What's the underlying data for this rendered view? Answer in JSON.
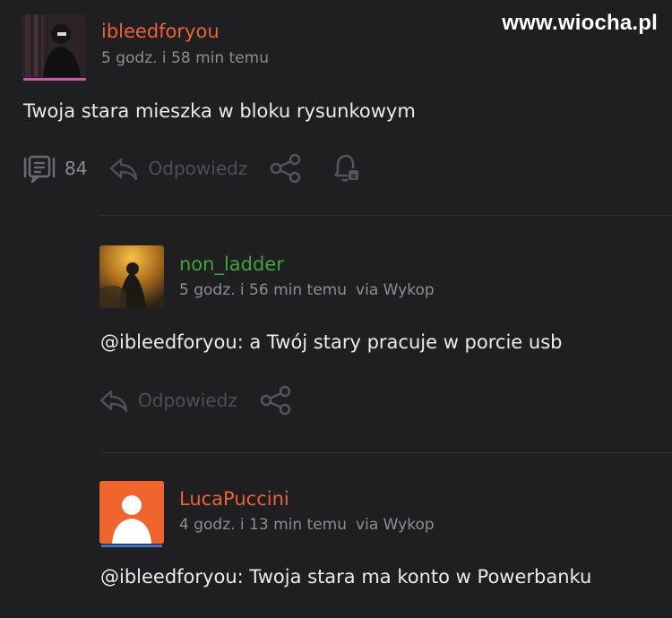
{
  "watermark": "www.wiocha.pl",
  "post": {
    "author": "ibleedforyou",
    "time": "5 godz. i 58 min temu",
    "text": "Twoja stara mieszka w bloku rysunkowym",
    "comment_count": "84",
    "reply_label": "Odpowiedz",
    "author_color": "#e8623c"
  },
  "comments": [
    {
      "author": "non_ladder",
      "time": "5 godz. i 56 min temu",
      "via": "via Wykop",
      "text": "@ibleedforyou: a Twój stary pracuje w porcie usb",
      "reply_label": "Odpowiedz",
      "author_color": "#3fa33f"
    },
    {
      "author": "LucaPuccini",
      "time": "4 godz. i 13 min temu",
      "via": "via Wykop",
      "text": "@ibleedforyou: Twoja stara ma konto w Powerbanku",
      "author_color": "#e8623c"
    }
  ]
}
